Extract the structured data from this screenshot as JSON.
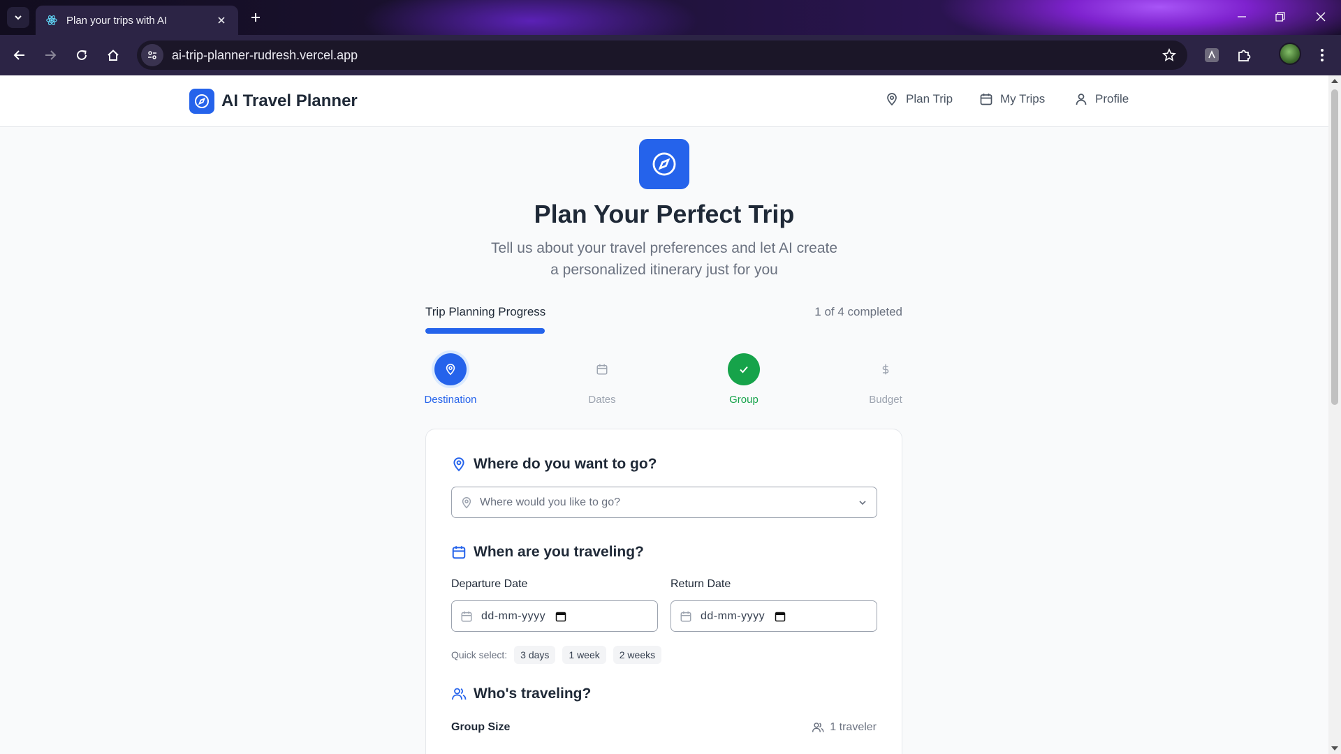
{
  "browser": {
    "tab_title": "Plan your trips with AI",
    "url": "ai-trip-planner-rudresh.vercel.app"
  },
  "header": {
    "brand": "AI Travel Planner",
    "nav": [
      {
        "label": "Plan Trip",
        "icon": "map-pin-icon"
      },
      {
        "label": "My Trips",
        "icon": "calendar-icon"
      },
      {
        "label": "Profile",
        "icon": "user-icon"
      }
    ]
  },
  "hero": {
    "title": "Plan Your Perfect Trip",
    "subtitle": "Tell us about your travel preferences and let AI create a personalized itinerary just for you"
  },
  "progress": {
    "label": "Trip Planning Progress",
    "count_text": "1 of 4 completed",
    "fraction": 0.25,
    "accent": "#2563eb"
  },
  "steps": [
    {
      "label": "Destination",
      "state": "active",
      "icon": "map-pin-icon"
    },
    {
      "label": "Dates",
      "state": "idle",
      "icon": "calendar-icon"
    },
    {
      "label": "Group",
      "state": "done",
      "icon": "check-icon"
    },
    {
      "label": "Budget",
      "state": "idle",
      "icon": "dollar-icon"
    }
  ],
  "form": {
    "destination": {
      "title": "Where do you want to go?",
      "placeholder": "Where would you like to go?"
    },
    "dates": {
      "title": "When are you traveling?",
      "departure_label": "Departure Date",
      "return_label": "Return Date",
      "date_placeholder": "dd-mm-yyyy",
      "quick_select_label": "Quick select:",
      "quick_options": [
        "3 days",
        "1 week",
        "2 weeks"
      ]
    },
    "group": {
      "title": "Who's traveling?",
      "size_label": "Group Size",
      "traveler_count": "1 traveler"
    }
  },
  "colors": {
    "primary": "#2563eb",
    "success": "#16a34a",
    "muted": "#9ca3af"
  }
}
